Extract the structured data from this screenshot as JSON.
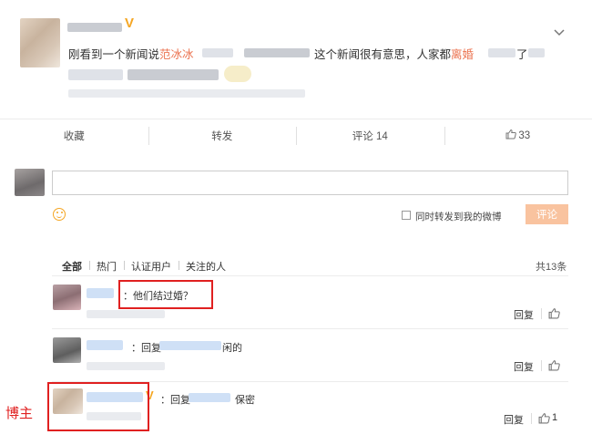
{
  "post": {
    "verified_mark": "V",
    "text_before": "刚看到一个新闻说",
    "text_highlight1": "范冰冰",
    "text_middle": "这个新闻很有意思，人家都",
    "text_highlight2": "离婚",
    "text_end": "了"
  },
  "actions": [
    {
      "label": "收藏"
    },
    {
      "label": "转发"
    },
    {
      "label": "评论 14"
    },
    {
      "label": "33"
    }
  ],
  "composer": {
    "input_value": "",
    "forward_label": "同时转发到我的微博",
    "submit_label": "评论"
  },
  "filter_tabs": [
    "全部",
    "热门",
    "认证用户",
    "关注的人"
  ],
  "total_count": "共13条",
  "comments": [
    {
      "text": "：他们结过婚？",
      "reply_label": "回复",
      "likes": ""
    },
    {
      "text_prefix": "：回复",
      "text_suffix": "闲的",
      "reply_label": "回复",
      "likes": ""
    },
    {
      "text_prefix": "：回复",
      "text_suffix": "保密",
      "reply_label": "回复",
      "likes": "1"
    }
  ],
  "annotation_label": "博主",
  "colors": {
    "highlight": "#eb7350",
    "annotation_red": "#e02020",
    "verified": "#f5a623",
    "button": "#f9c39f"
  }
}
